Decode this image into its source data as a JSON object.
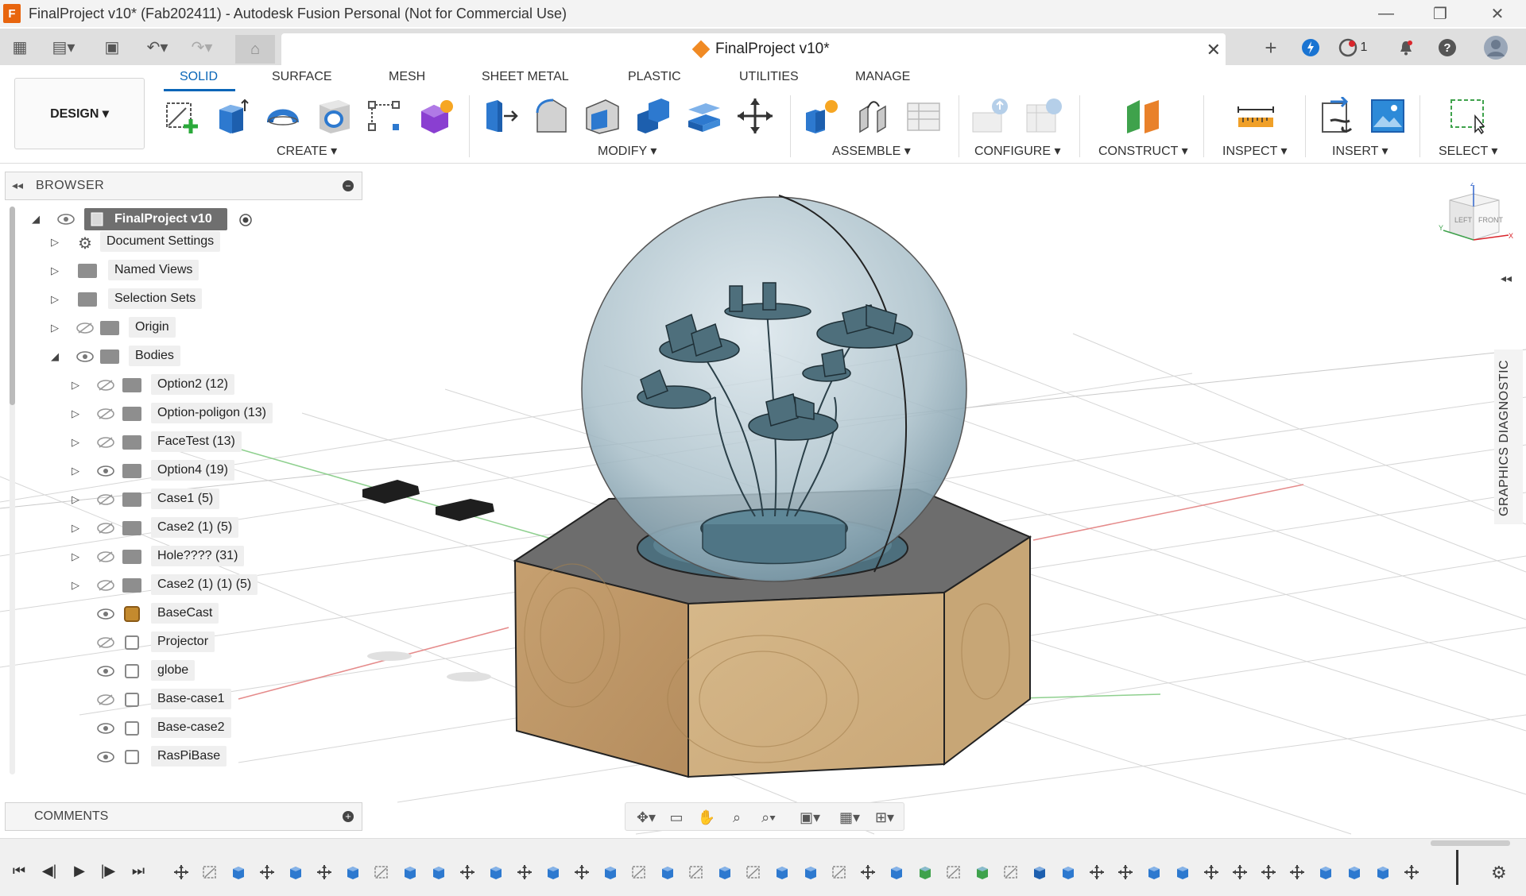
{
  "window": {
    "title": "FinalProject v10* (Fab202411) - Autodesk Fusion Personal (Not for Commercial Use)",
    "logo_letter": "F",
    "minimize": "—",
    "restore": "❐",
    "close": "✕"
  },
  "tabbar": {
    "document_tab": "FinalProject v10*",
    "close": "✕",
    "notification_count": "1"
  },
  "toolbar": {
    "workspace": "DESIGN ▾",
    "workspace_tabs": [
      "SOLID",
      "SURFACE",
      "MESH",
      "SHEET METAL",
      "PLASTIC",
      "UTILITIES",
      "MANAGE"
    ],
    "groups": {
      "create": "CREATE ▾",
      "modify": "MODIFY ▾",
      "assemble": "ASSEMBLE ▾",
      "configure": "CONFIGURE ▾",
      "construct": "CONSTRUCT ▾",
      "inspect": "INSPECT ▾",
      "insert": "INSERT ▾",
      "select": "SELECT ▾"
    }
  },
  "browser": {
    "title": "BROWSER",
    "root": "FinalProject v10",
    "items": [
      {
        "label": "Document Settings"
      },
      {
        "label": "Named Views"
      },
      {
        "label": "Selection Sets"
      },
      {
        "label": "Origin"
      },
      {
        "label": "Bodies"
      }
    ],
    "components": [
      {
        "label": "Option2 (12)"
      },
      {
        "label": "Option-poligon (13)"
      },
      {
        "label": "FaceTest (13)"
      },
      {
        "label": "Option4 (19)"
      },
      {
        "label": "Case1 (5)"
      },
      {
        "label": "Case2 (1) (5)"
      },
      {
        "label": "Hole???? (31)"
      },
      {
        "label": "Case2 (1) (1) (5)"
      }
    ],
    "bodies": [
      {
        "label": "BaseCast"
      },
      {
        "label": "Projector"
      },
      {
        "label": "globe"
      },
      {
        "label": "Base-case1"
      },
      {
        "label": "Base-case2"
      },
      {
        "label": "RasPiBase"
      }
    ]
  },
  "comments": {
    "title": "COMMENTS"
  },
  "side_panel": {
    "label": "GRAPHICS DIAGNOSTIC"
  },
  "viewcube": {
    "left": "LEFT",
    "front": "FRONT",
    "z": "Z",
    "x": "X",
    "y": "Y"
  },
  "colors": {
    "accent": "#0a66b8",
    "wood": "#c9a77a",
    "glass": "#9fb9c4",
    "grid": "#d8d8d8"
  }
}
